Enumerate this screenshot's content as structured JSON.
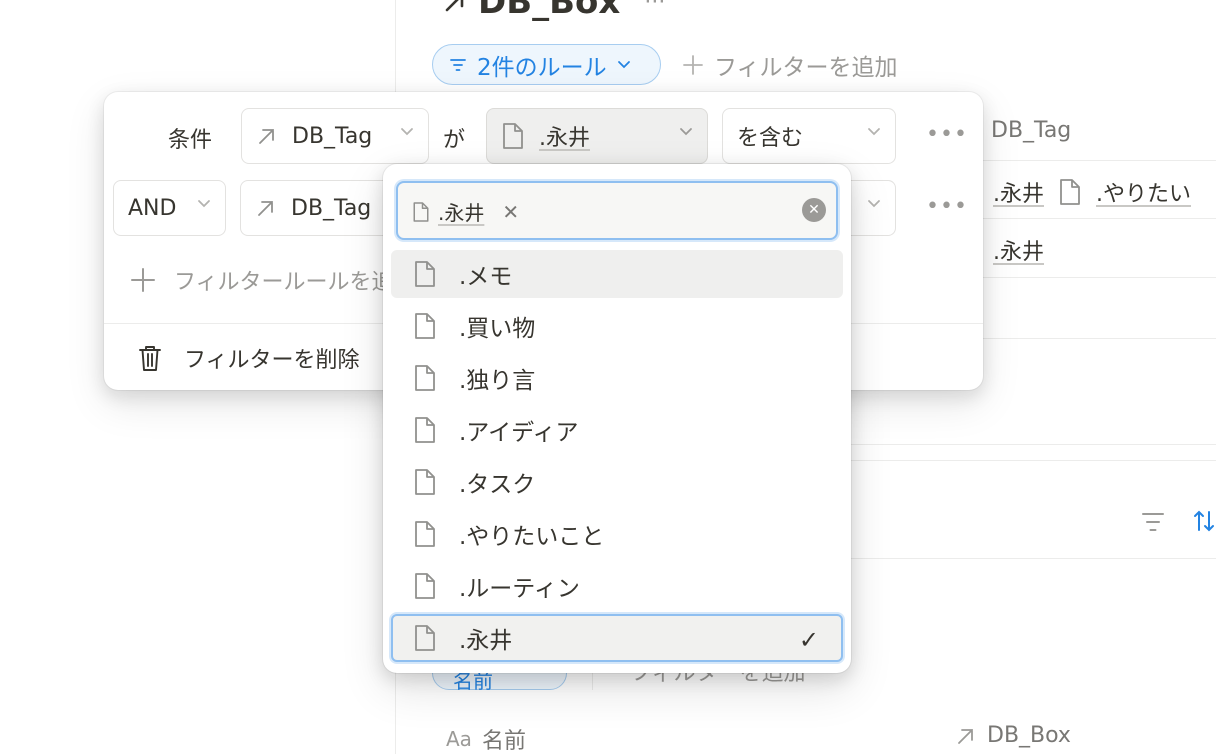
{
  "page": {
    "title": "DB_Box",
    "title_more": "···",
    "rule_chip_label": "2件のルール",
    "add_filter_label": "フィルターを追加"
  },
  "background_table": {
    "column_header": "DB_Tag",
    "row1_value1": ".永井",
    "row1_value2": ".やりたい",
    "row2_value": ".永井"
  },
  "lower_view": {
    "chip_label": "名前",
    "add_filter_label": "フィルターを追加",
    "columns": [
      {
        "icon": "Aa",
        "label": "名前"
      },
      {
        "label": "DB_Box"
      }
    ]
  },
  "filter_popover": {
    "rule1": {
      "prefix": "条件",
      "property": "DB_Tag",
      "connector": "が",
      "value": ".永井",
      "operator": "を含む"
    },
    "rule2": {
      "prefix": "AND",
      "property": "DB_Tag"
    },
    "add_rule_label": "フィルタールールを追加",
    "delete_label": "フィルターを削除"
  },
  "dropdown": {
    "selected_token": ".永井",
    "options": [
      {
        "label": ".メモ",
        "state": "hover"
      },
      {
        "label": ".買い物",
        "state": ""
      },
      {
        "label": ".独り言",
        "state": ""
      },
      {
        "label": ".アイディア",
        "state": ""
      },
      {
        "label": ".タスク",
        "state": ""
      },
      {
        "label": ".やりたいこと",
        "state": ""
      },
      {
        "label": ".ルーティン",
        "state": ""
      },
      {
        "label": ".永井",
        "state": "selected"
      }
    ],
    "check_mark": "✓"
  },
  "colors": {
    "accent": "#2383e2",
    "focus_ring": "#8fbff0",
    "muted_text": "#9b9a97"
  }
}
